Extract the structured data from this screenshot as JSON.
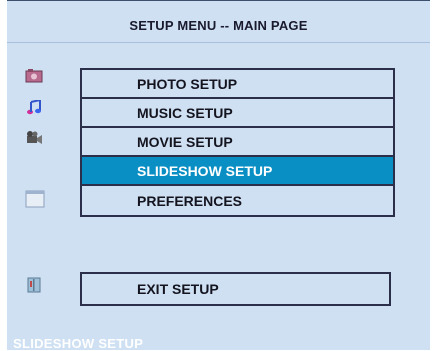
{
  "header": {
    "title": "SETUP MENU -- MAIN PAGE"
  },
  "menu": {
    "items": [
      {
        "label": "PHOTO SETUP",
        "icon": "photo-icon"
      },
      {
        "label": "MUSIC SETUP",
        "icon": "music-icon"
      },
      {
        "label": "MOVIE SETUP",
        "icon": "movie-camera-icon"
      },
      {
        "label": "SLIDESHOW SETUP",
        "icon": "slideshow-icon",
        "selected": true
      },
      {
        "label": "PREFERENCES",
        "icon": ""
      }
    ],
    "exit_label": "EXIT SETUP",
    "exit_icon": "exit-door-icon"
  },
  "status": {
    "text": "SLIDESHOW SETUP"
  },
  "colors": {
    "background": "#cfe0f3",
    "selected": "#0a8fc4",
    "border": "#2b2f4a"
  }
}
